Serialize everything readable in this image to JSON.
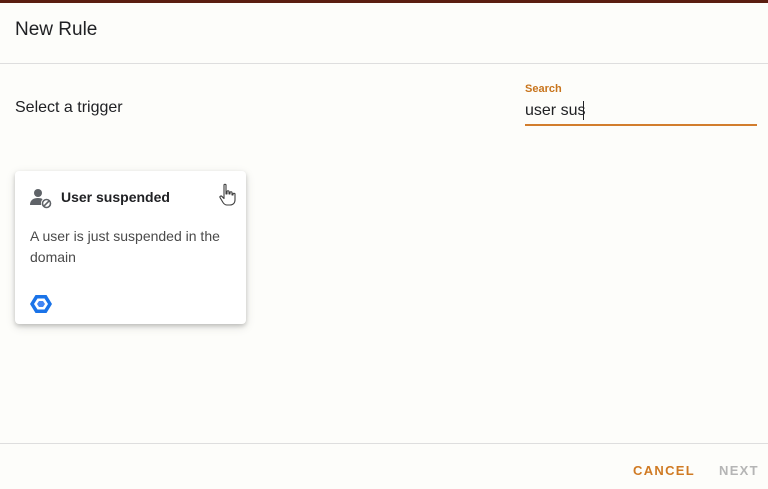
{
  "dialog": {
    "title": "New Rule"
  },
  "trigger_section": {
    "label": "Select a trigger"
  },
  "search": {
    "label": "Search",
    "value": "user sus"
  },
  "trigger_card": {
    "icon": "user-block-icon",
    "title": "User suspended",
    "description": "A user is just suspended in the domain",
    "logo": "google-cloud-hexagon-icon"
  },
  "footer": {
    "cancel_label": "CANCEL",
    "next_label": "NEXT"
  },
  "colors": {
    "accent": "#d07a23",
    "disabled": "#b5b5b5",
    "logo_blue": "#1a73e8"
  }
}
